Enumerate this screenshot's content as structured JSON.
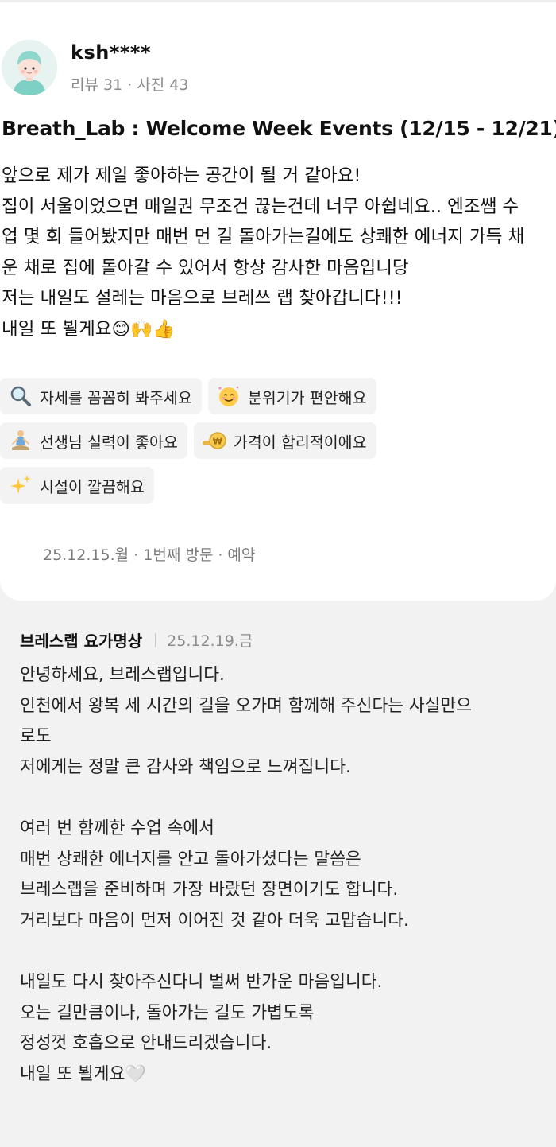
{
  "review": {
    "username": "ksh****",
    "meta": "리뷰 31 · 사진 43",
    "title": "Breath_Lab : Welcome Week Events (12/15 - 12/21)",
    "body_lines": [
      "앞으로 제가 제일 좋아하는 공간이 될 거 같아요!",
      "집이 서울이었으면 매일권 무조건 끊는건데 너무 아쉽네요.. 엔조쌤 수",
      "업 몇 회 들어봤지만 매번 먼 길 돌아가는길에도 상쾌한 에너지 가득 채",
      "운 채로 집에 돌아갈 수 있어서 항상 감사한 마음입니당",
      "저는 내일도 설레는 마음으로 브레쓰 랩 찾아갑니다!!!",
      "내일 또 뵐게요😊🙌👍"
    ],
    "tags": [
      {
        "icon": "magnifier-icon",
        "glyph": "🔍",
        "label": "자세를 꼼꼼히 봐주세요"
      },
      {
        "icon": "smiling-face-icon",
        "glyph": "☺️",
        "label": "분위기가 편안해요"
      },
      {
        "icon": "meditation-person-icon",
        "glyph": "🧘",
        "label": "선생님 실력이 좋아요"
      },
      {
        "icon": "coin-icon",
        "glyph": "🪙",
        "label": "가격이 합리적이에요"
      },
      {
        "icon": "sparkles-icon",
        "glyph": "✨",
        "label": "시설이 깔끔해요"
      }
    ],
    "visit_info": "25.12.15.월 · 1번째 방문 · 예약"
  },
  "reply": {
    "author": "브레스랩 요가명상",
    "date": "25.12.19.금",
    "body_lines": [
      "안녕하세요, 브레스랩입니다.",
      "인천에서 왕복 세 시간의 길을 오가며 함께해 주신다는 사실만으",
      "로도",
      "저에게는 정말 큰 감사와 책임으로 느껴집니다.",
      "",
      "여러 번 함께한 수업 속에서",
      "매번 상쾌한 에너지를 안고 돌아가셨다는 말씀은",
      "브레스랩을 준비하며 가장 바랐던 장면이기도 합니다.",
      "거리보다 마음이 먼저 이어진 것 같아 더욱 고맙습니다.",
      "",
      "내일도 다시 찾아주신다니 벌써 반가운 마음입니다.",
      "오는 길만큼이나, 돌아가는 길도 가볍도록",
      "정성껏 호흡으로 안내드리겠습니다.",
      "내일 또 뵐게요🤍"
    ]
  }
}
